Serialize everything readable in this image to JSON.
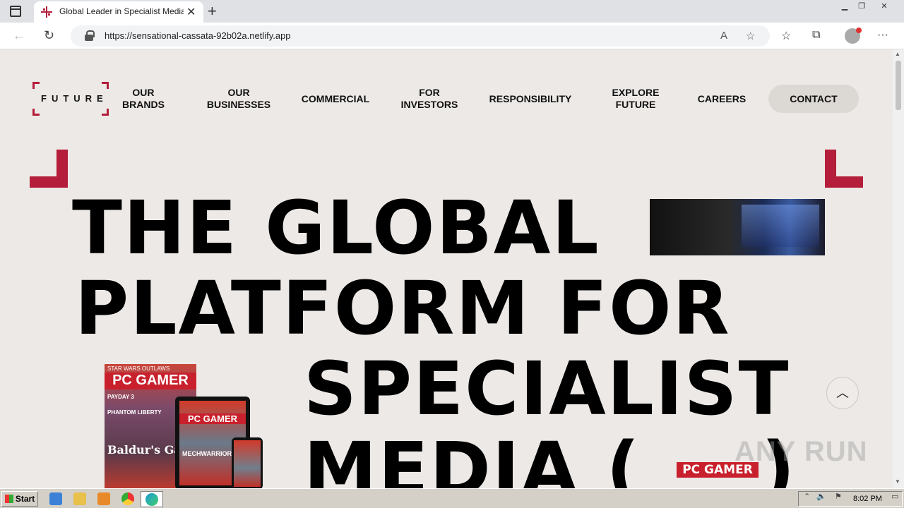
{
  "browser": {
    "tab_title": "Global Leader in Specialist Media",
    "url": "https://sensational-cassata-92b02a.netlify.app"
  },
  "site": {
    "logo_text": "FUTURE",
    "nav": [
      {
        "line1": "OUR",
        "line2": "BRANDS"
      },
      {
        "line1": "OUR",
        "line2": "BUSINESSES"
      },
      {
        "line1": "COMMERCIAL",
        "line2": ""
      },
      {
        "line1": "FOR",
        "line2": "INVESTORS"
      },
      {
        "line1": "RESPONSIBILITY",
        "line2": ""
      },
      {
        "line1": "EXPLORE",
        "line2": "FUTURE"
      },
      {
        "line1": "CAREERS",
        "line2": ""
      }
    ],
    "contact_label": "CONTACT",
    "hero": {
      "line1": "THE GLOBAL",
      "line2": "PLATFORM FOR",
      "line3": "SPECIALIST",
      "line4": "MEDIA (",
      "line4_close": ")"
    },
    "brand_badge": "PC GAMER",
    "magazine": {
      "title": "PC GAMER",
      "subtitle": "STAR WARS OUTLAWS",
      "headline1": "PAYDAY 3",
      "headline2": "PHANTOM LIBERTY",
      "headline3": "Baldur's Gate",
      "tablet_title": "PC GAMER",
      "tablet_headline": "MECHWARRIOR"
    },
    "scroll_top_icon": "chevron-up-icon"
  },
  "watermark": "ANY RUN",
  "taskbar": {
    "start_label": "Start",
    "clock": "8:02 PM"
  },
  "colors": {
    "brand_red": "#b41e3a",
    "page_bg": "#ece9e6",
    "pc_gamer_red": "#c8202c"
  }
}
